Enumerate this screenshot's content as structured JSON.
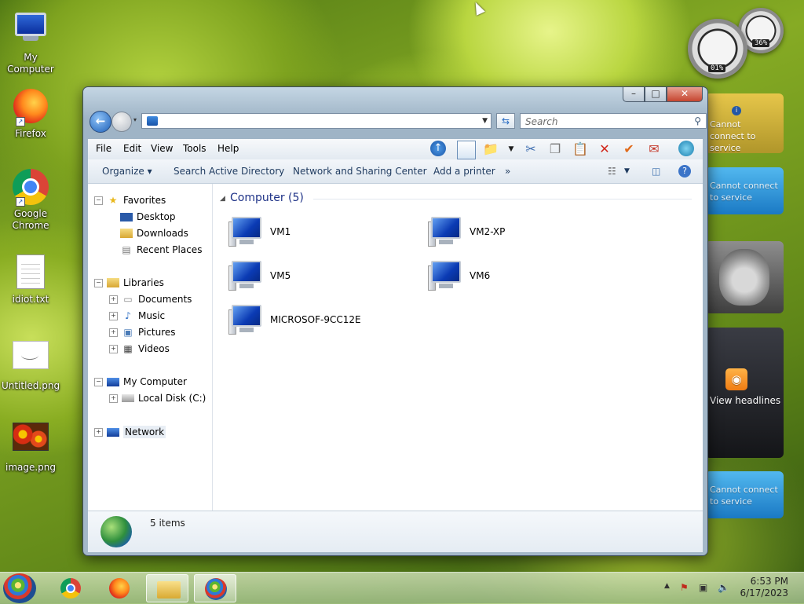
{
  "desktop": {
    "icons": [
      {
        "label": "My Computer",
        "icon": "computer-icon"
      },
      {
        "label": "Firefox",
        "icon": "firefox-icon"
      },
      {
        "label": "Google Chrome",
        "icon": "chrome-icon"
      },
      {
        "label": "idiot.txt",
        "icon": "text-file-icon"
      },
      {
        "label": "Untitled.png",
        "icon": "image-file-icon"
      },
      {
        "label": "image.png",
        "icon": "image-file-icon"
      }
    ]
  },
  "gadgets": {
    "cpu_reading": "01%",
    "memory_reading": "36%",
    "info_text_1": "Cannot connect to service",
    "info_text_2": "Cannot connect to service",
    "info_text_3": "Cannot connect to service",
    "feed_text": "View headlines"
  },
  "window": {
    "buttons": {
      "minimize": "–",
      "maximize": "□",
      "close": "✕"
    },
    "address": {
      "value": ""
    },
    "search": {
      "placeholder": "Search"
    },
    "menu": [
      "File",
      "Edit",
      "View",
      "Tools",
      "Help"
    ],
    "commands": [
      "Organize ▾",
      "Search Active Directory",
      "Network and Sharing Center",
      "Add a printer",
      "»"
    ],
    "nav": {
      "favorites": "Favorites",
      "desktop": "Desktop",
      "downloads": "Downloads",
      "recent_places": "Recent Places",
      "libraries": "Libraries",
      "documents": "Documents",
      "music": "Music",
      "pictures": "Pictures",
      "videos": "Videos",
      "my_computer": "My Computer",
      "local_disk": "Local Disk (C:)",
      "network": "Network"
    },
    "group_header": "Computer (5)",
    "items": [
      "VM1",
      "VM2-XP",
      "VM5",
      "VM6",
      "MICROSOF-9CC12E"
    ],
    "details": {
      "count": "5 items"
    }
  },
  "taskbar": {
    "time": "6:53 PM",
    "date": "6/17/2023",
    "apps": [
      "chrome",
      "firefox",
      "explorer",
      "windows"
    ]
  },
  "colors": {
    "accent": "#1e3287",
    "titlebar": "#a4b8c8"
  }
}
